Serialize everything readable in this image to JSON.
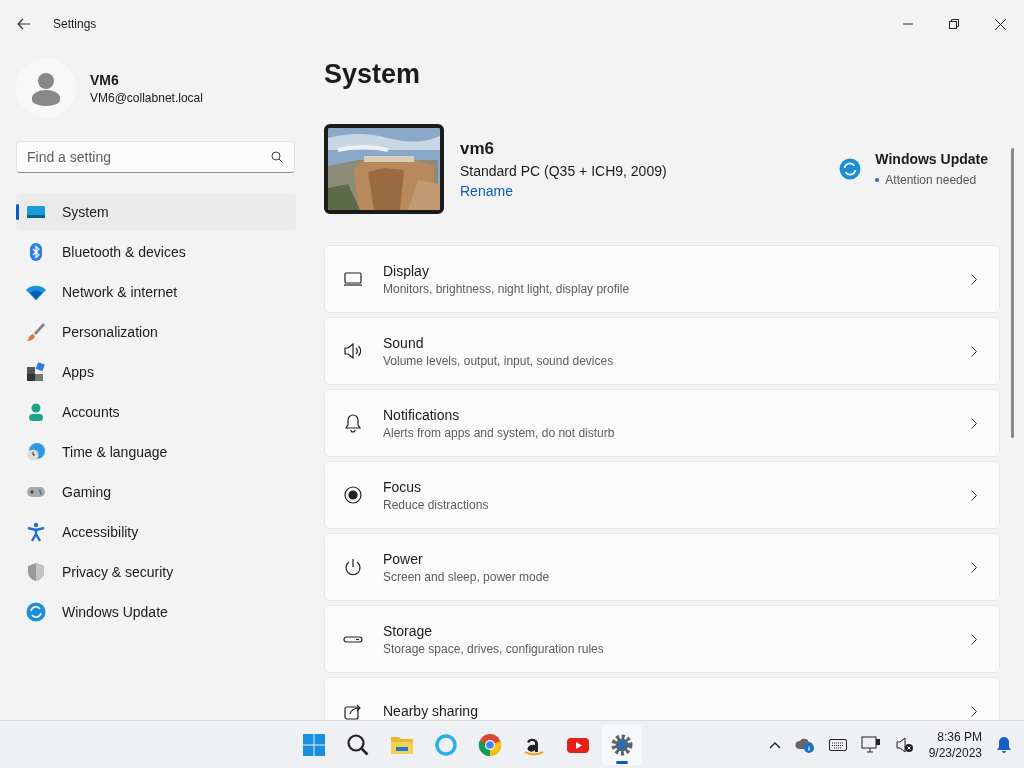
{
  "window": {
    "title": "Settings"
  },
  "account": {
    "name": "VM6",
    "email": "VM6@collabnet.local"
  },
  "search": {
    "placeholder": "Find a setting"
  },
  "sidebar": {
    "items": [
      {
        "label": "System",
        "selected": true
      },
      {
        "label": "Bluetooth & devices",
        "selected": false
      },
      {
        "label": "Network & internet",
        "selected": false
      },
      {
        "label": "Personalization",
        "selected": false
      },
      {
        "label": "Apps",
        "selected": false
      },
      {
        "label": "Accounts",
        "selected": false
      },
      {
        "label": "Time & language",
        "selected": false
      },
      {
        "label": "Gaming",
        "selected": false
      },
      {
        "label": "Accessibility",
        "selected": false
      },
      {
        "label": "Privacy & security",
        "selected": false
      },
      {
        "label": "Windows Update",
        "selected": false
      }
    ]
  },
  "page": {
    "title": "System"
  },
  "device": {
    "name": "vm6",
    "model": "Standard PC (Q35 + ICH9, 2009)",
    "rename": "Rename"
  },
  "update": {
    "title": "Windows Update",
    "status": "Attention needed"
  },
  "settings": [
    {
      "title": "Display",
      "subtitle": "Monitors, brightness, night light, display profile"
    },
    {
      "title": "Sound",
      "subtitle": "Volume levels, output, input, sound devices"
    },
    {
      "title": "Notifications",
      "subtitle": "Alerts from apps and system, do not disturb"
    },
    {
      "title": "Focus",
      "subtitle": "Reduce distractions"
    },
    {
      "title": "Power",
      "subtitle": "Screen and sleep, power mode"
    },
    {
      "title": "Storage",
      "subtitle": "Storage space, drives, configuration rules"
    },
    {
      "title": "Nearby sharing"
    }
  ],
  "taskbar": {
    "apps": [
      {
        "selected": false
      },
      {
        "selected": false
      },
      {
        "selected": false
      },
      {
        "selected": false
      },
      {
        "selected": false
      },
      {
        "selected": false
      },
      {
        "selected": false
      },
      {
        "selected": true
      }
    ],
    "time": "8:36 PM",
    "date": "9/23/2023"
  }
}
